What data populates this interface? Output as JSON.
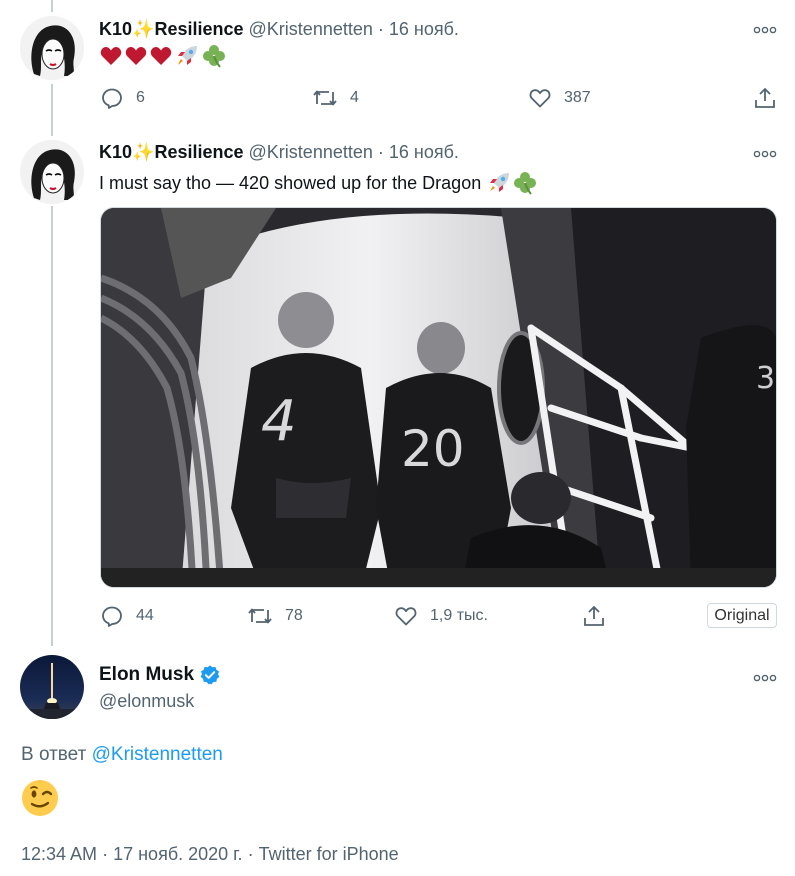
{
  "tweet1": {
    "name": "K10",
    "name_emoji": "✨",
    "name_suffix": "Resilience",
    "handle": "@Kristennetten",
    "separator": "·",
    "date": "16 нояб.",
    "text_emojis": "hearts, rocket, shamrock",
    "replies": "6",
    "retweets": "4",
    "likes": "387"
  },
  "tweet2": {
    "name": "K10",
    "name_emoji": "✨",
    "name_suffix": "Resilience",
    "handle": "@Kristennetten",
    "separator": "·",
    "date": "16 нояб.",
    "text": "I must say tho — 420 showed up for the Dragon",
    "replies": "44",
    "retweets": "78",
    "likes": "1,9 тыс.",
    "original_label": "Original"
  },
  "main_tweet": {
    "name": "Elon Musk",
    "handle": "@elonmusk",
    "reply_prefix": "В ответ",
    "reply_handle": "@Kristennetten",
    "time": "12:34 AM",
    "date": "17 нояб. 2020 г.",
    "source": "Twitter for iPhone",
    "separator": "·"
  },
  "icons": {
    "reply": "reply-icon",
    "retweet": "retweet-icon",
    "like": "like-icon",
    "share": "share-icon",
    "more": "more-icon",
    "verified": "verified-badge-icon"
  },
  "colors": {
    "link": "#1d9bf0",
    "secondary": "#536471",
    "heart": "#d0213a",
    "verified": "#1d9bf0"
  }
}
